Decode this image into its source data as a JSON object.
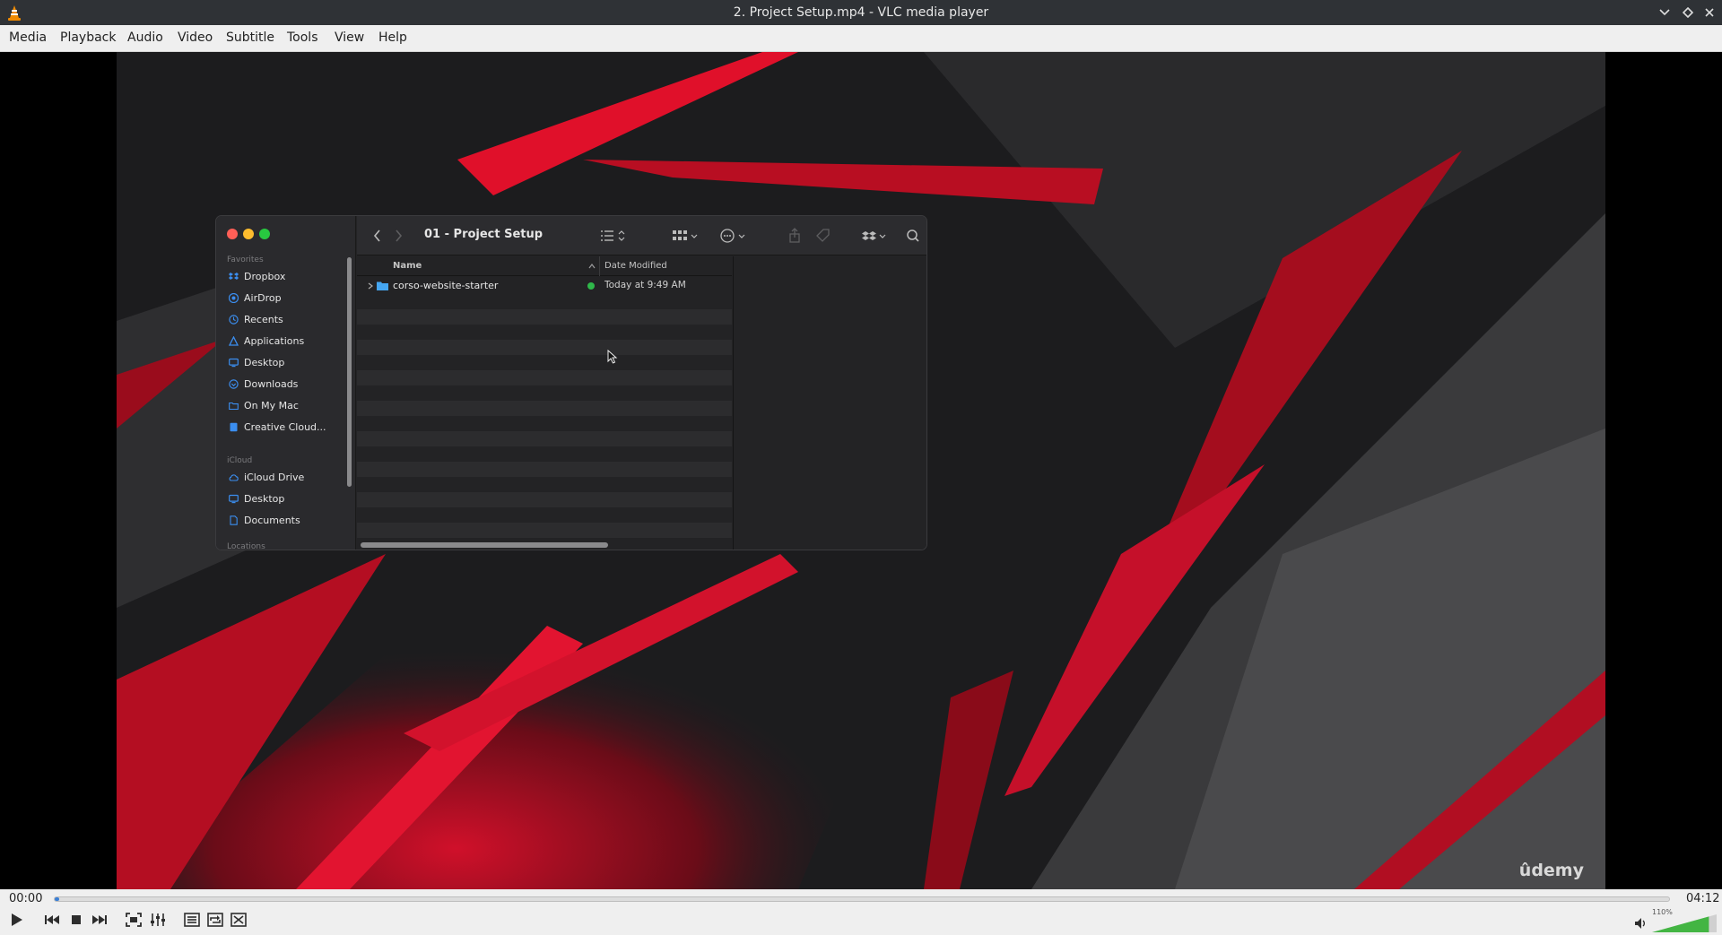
{
  "window": {
    "title": "2. Project Setup.mp4 - VLC media player",
    "app_icon": "vlc-cone-icon",
    "buttons": [
      "minimize-icon",
      "maximize-icon",
      "close-icon"
    ]
  },
  "menu": {
    "items": [
      {
        "label": "Media"
      },
      {
        "label": "Playback"
      },
      {
        "label": "Audio"
      },
      {
        "label": "Video"
      },
      {
        "label": "Subtitle"
      },
      {
        "label": "Tools"
      },
      {
        "label": "View"
      },
      {
        "label": "Help"
      }
    ]
  },
  "video": {
    "watermark": "ûdemy",
    "finder": {
      "folder_title": "01 - Project Setup",
      "sidebar": {
        "favorites_label": "Favorites",
        "favorites": [
          {
            "label": "Dropbox",
            "icon": "dropbox-icon"
          },
          {
            "label": "AirDrop",
            "icon": "airdrop-icon"
          },
          {
            "label": "Recents",
            "icon": "clock-icon"
          },
          {
            "label": "Applications",
            "icon": "applications-icon"
          },
          {
            "label": "Desktop",
            "icon": "desktop-icon"
          },
          {
            "label": "Downloads",
            "icon": "downloads-icon"
          },
          {
            "label": "On My Mac",
            "icon": "folder-icon"
          },
          {
            "label": "Creative Cloud...",
            "icon": "document-icon"
          }
        ],
        "icloud_label": "iCloud",
        "icloud": [
          {
            "label": "iCloud Drive",
            "icon": "cloud-icon"
          },
          {
            "label": "Desktop",
            "icon": "desktop-icon"
          },
          {
            "label": "Documents",
            "icon": "document-icon"
          }
        ],
        "locations_label": "Locations"
      },
      "columns": {
        "name": "Name",
        "date": "Date Modified"
      },
      "files": [
        {
          "name": "corso-website-starter",
          "modified": "Today at 9:49 AM",
          "synced": true
        }
      ]
    }
  },
  "controls": {
    "elapsed": "00:00",
    "duration": "04:12",
    "progress": 0.003,
    "volume_label": "110%",
    "volume_level": 1.1,
    "accent": "#3a7fd5"
  }
}
